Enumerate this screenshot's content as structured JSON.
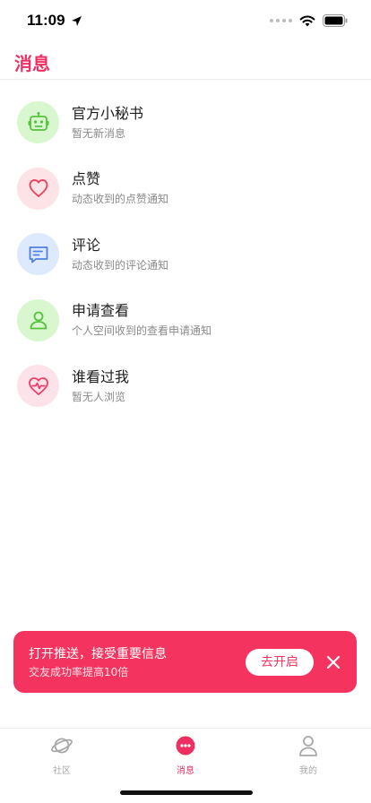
{
  "status_bar": {
    "time": "11:09",
    "location_icon": "location-arrow-icon",
    "signal_icon": "signal-dots-icon",
    "wifi_icon": "wifi-icon",
    "battery_icon": "battery-icon"
  },
  "header": {
    "title": "消息"
  },
  "messages": [
    {
      "title": "官方小秘书",
      "subtitle": "暂无新消息",
      "icon": "robot-icon",
      "bg": "#d9f7cf",
      "color": "#55c23e"
    },
    {
      "title": "点赞",
      "subtitle": "动态收到的点赞通知",
      "icon": "heart-icon",
      "bg": "#fde3e6",
      "color": "#e8465e"
    },
    {
      "title": "评论",
      "subtitle": "动态收到的评论通知",
      "icon": "comment-icon",
      "bg": "#dde9fd",
      "color": "#4f80e3"
    },
    {
      "title": "申请查看",
      "subtitle": "个人空间收到的查看申请通知",
      "icon": "user-icon",
      "bg": "#d9f7cf",
      "color": "#55c23e"
    },
    {
      "title": "谁看过我",
      "subtitle": "暂无人浏览",
      "icon": "heart-pulse-icon",
      "bg": "#fde3e9",
      "color": "#ee3d68"
    }
  ],
  "push_banner": {
    "title": "打开推送，接受重要信息",
    "subtitle": "交友成功率提高10倍",
    "button_label": "去开启",
    "close_icon": "close-icon",
    "color": "#f4345f"
  },
  "tab_bar": {
    "tabs": [
      {
        "label": "社区",
        "icon": "planet-icon",
        "active": false
      },
      {
        "label": "消息",
        "icon": "chat-bubble-icon",
        "active": true
      },
      {
        "label": "我的",
        "icon": "person-icon",
        "active": false
      }
    ],
    "active_color": "#ef2f62",
    "inactive_color": "#a8a8a8"
  }
}
